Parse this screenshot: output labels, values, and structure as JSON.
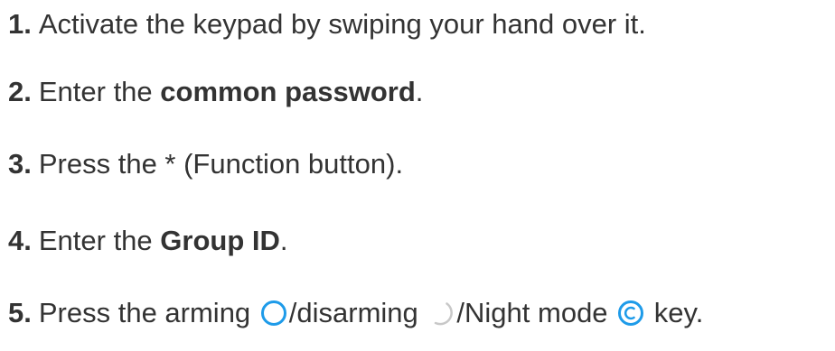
{
  "steps": [
    {
      "number": "1.",
      "text": "Activate the keypad by swiping your hand over it."
    },
    {
      "number": "2.",
      "text_before": "Enter the ",
      "bold": "common password",
      "text_after": "."
    },
    {
      "number": "3.",
      "text": "Press the * (Function button)."
    },
    {
      "number": "4.",
      "text_before": "Enter the ",
      "bold": "Group ID",
      "text_after": "."
    },
    {
      "number": "5.",
      "text_before": "Press the arming ",
      "text_middle_1": "/disarming ",
      "text_middle_2": "/Night mode ",
      "text_after": " key."
    }
  ],
  "colors": {
    "text": "#333333",
    "arm_icon": "#1e9be9",
    "disarm_icon": "#c8c8c8",
    "night_icon": "#1e9be9"
  },
  "icons": {
    "arm": "arm-ring-icon",
    "disarm": "disarm-partial-ring-icon",
    "night": "night-mode-ring-icon"
  }
}
